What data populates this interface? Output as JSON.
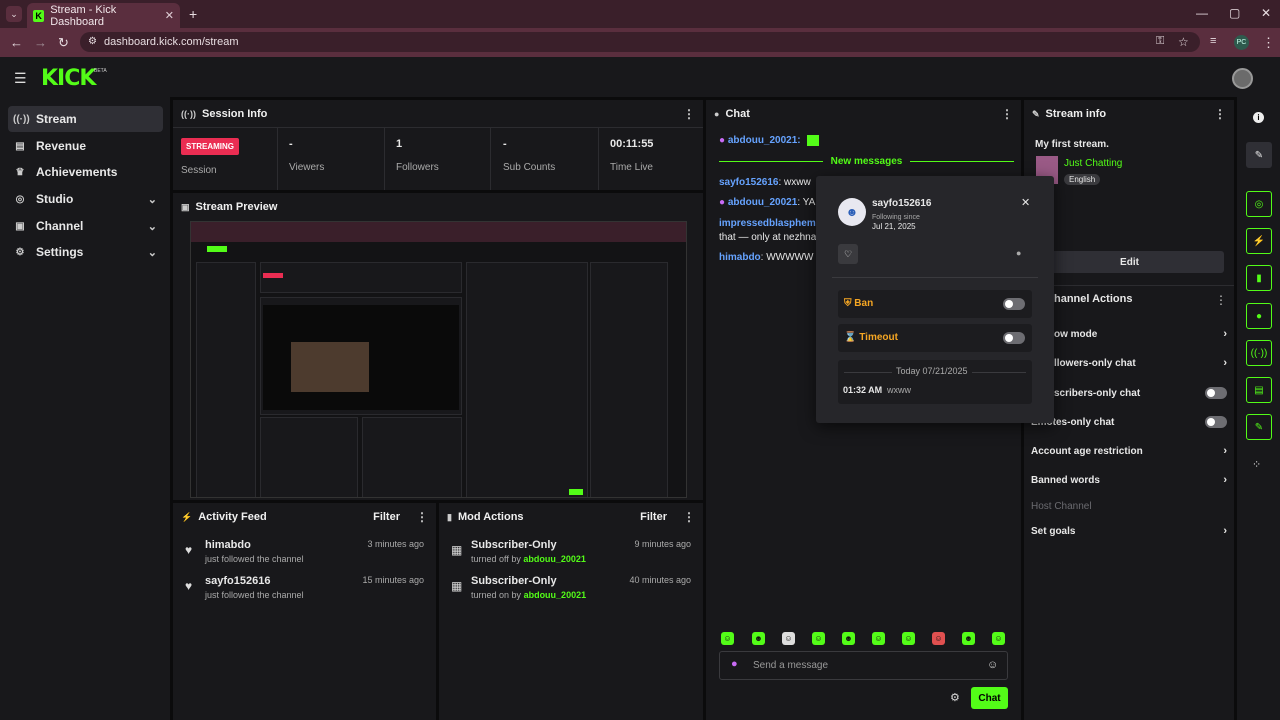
{
  "browser": {
    "tab_title": "Stream - Kick Dashboard",
    "tab_favicon": "K",
    "tab_close": "✕",
    "new_tab": "+",
    "url": "dashboard.kick.com/stream",
    "profile": "PC",
    "window_controls": {
      "minimize": "—",
      "maximize": "▢",
      "close": "✕"
    }
  },
  "kick": {
    "logo": "KICK",
    "beta": "BETA"
  },
  "nav": {
    "items": [
      {
        "label": "Stream",
        "icon": "broadcast-icon"
      },
      {
        "label": "Revenue",
        "icon": "revenue-icon"
      },
      {
        "label": "Achievements",
        "icon": "trophy-icon"
      },
      {
        "label": "Studio",
        "icon": "studio-icon"
      },
      {
        "label": "Channel",
        "icon": "channel-icon"
      },
      {
        "label": "Settings",
        "icon": "gear-icon"
      }
    ]
  },
  "session": {
    "title": "Session Info",
    "badge": "STREAMING",
    "badge_label": "Session",
    "viewers_value": "-",
    "viewers_label": "Viewers",
    "followers_value": "1",
    "followers_label": "Followers",
    "subs_value": "-",
    "subs_label": "Sub Counts",
    "time_value": "00:11:55",
    "time_label": "Time Live"
  },
  "preview": {
    "title": "Stream Preview"
  },
  "activity": {
    "title": "Activity Feed",
    "filter": "Filter",
    "items": [
      {
        "name": "himabdo",
        "sub": "just followed the channel",
        "time": "3 minutes ago"
      },
      {
        "name": "sayfo152616",
        "sub": "just followed the channel",
        "time": "15 minutes ago"
      }
    ]
  },
  "mod": {
    "title": "Mod Actions",
    "filter": "Filter",
    "items": [
      {
        "name": "Subscriber-Only",
        "sub_prefix": "turned off by",
        "user": "abdouu_20021",
        "time": "9 minutes ago"
      },
      {
        "name": "Subscriber-Only",
        "sub_prefix": "turned on by",
        "user": "abdouu_20021",
        "time": "40 minutes ago"
      }
    ]
  },
  "chat": {
    "title": "Chat",
    "pinned_user": "abdouu_20021:",
    "new_messages": "New messages",
    "messages": [
      {
        "user": "sayfo152616",
        "text": ": wxww"
      },
      {
        "user": "abdouu_20021",
        "text": ": YA I"
      },
      {
        "user": "impressedblasphemei4",
        "text": ""
      },
      {
        "user": "",
        "text": "that — only at nezhna .c"
      },
      {
        "user": "himabdo",
        "text": ": WWWWW"
      }
    ],
    "placeholder": "Send a message",
    "send": "Chat"
  },
  "popup": {
    "username": "sayfo152616",
    "following_since_label": "Following since",
    "following_since": "Jul 21, 2025",
    "ban": "Ban",
    "timeout": "Timeout",
    "date_header": "Today 07/21/2025",
    "log_time": "01:32 AM",
    "log_text": "wxww"
  },
  "stream_info": {
    "title": "Stream info",
    "stream_title": "My first stream.",
    "category": "Just Chatting",
    "language": "English",
    "edit": "Edit"
  },
  "channel_actions": {
    "title": "hannel Actions",
    "items": [
      {
        "label": "ow mode",
        "kind": "chevron"
      },
      {
        "label": "llowers-only chat",
        "kind": "chevron"
      },
      {
        "label": "scribers-only chat",
        "kind": "toggle"
      },
      {
        "label": "Emotes-only chat",
        "kind": "toggle"
      },
      {
        "label": "Account age restriction",
        "kind": "chevron"
      },
      {
        "label": "Banned words",
        "kind": "chevron"
      },
      {
        "label": "Host Channel",
        "kind": "disabled"
      },
      {
        "label": "Set goals",
        "kind": "chevron"
      }
    ]
  },
  "colors": {
    "accent": "#53fc18",
    "live": "#ea2d52",
    "username": "#66a3ff",
    "warning": "#f5a623"
  }
}
